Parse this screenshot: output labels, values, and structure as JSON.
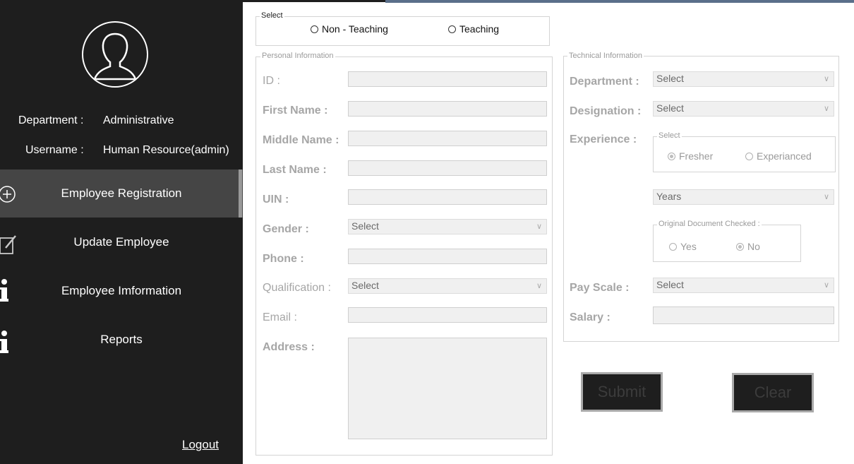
{
  "sidebar": {
    "department_label": "Department :",
    "department_value": "Administrative",
    "username_label": "Username :",
    "username_value": "Human Resource(admin)",
    "nav": [
      {
        "label": "Employee Registration",
        "icon": "plus-circle-icon"
      },
      {
        "label": "Update  Employee",
        "icon": "edit-icon"
      },
      {
        "label": "Employee Imformation",
        "icon": "info-icon"
      },
      {
        "label": "Reports",
        "icon": "info-icon"
      }
    ],
    "logout": "Logout"
  },
  "select_group": {
    "title": "Select",
    "options": [
      "Non - Teaching",
      "Teaching"
    ]
  },
  "personal": {
    "title": "Personal Information",
    "id_label": "ID :",
    "first_name_label": "First Name :",
    "middle_name_label": "Middle Name :",
    "last_name_label": "Last Name :",
    "uin_label": "UIN :",
    "gender_label": "Gender :",
    "gender_value": "Select",
    "phone_label": "Phone :",
    "qualification_label": "Qualification :",
    "qualification_value": "Select",
    "email_label": "Email :",
    "address_label": "Address :"
  },
  "technical": {
    "title": "Technical Information",
    "department_label": "Department :",
    "department_value": "Select",
    "designation_label": "Designation :",
    "designation_value": "Select",
    "experience_label": "Experience :",
    "experience_group_title": "Select",
    "experience_options": [
      "Fresher",
      "Experianced"
    ],
    "years_value": "Years",
    "doc_group_title": "Original Document Checked :",
    "doc_options": [
      "Yes",
      "No"
    ],
    "payscale_label": "Pay Scale :",
    "payscale_value": "Select",
    "salary_label": "Salary :"
  },
  "buttons": {
    "submit": "Submit",
    "clear": "Clear"
  }
}
